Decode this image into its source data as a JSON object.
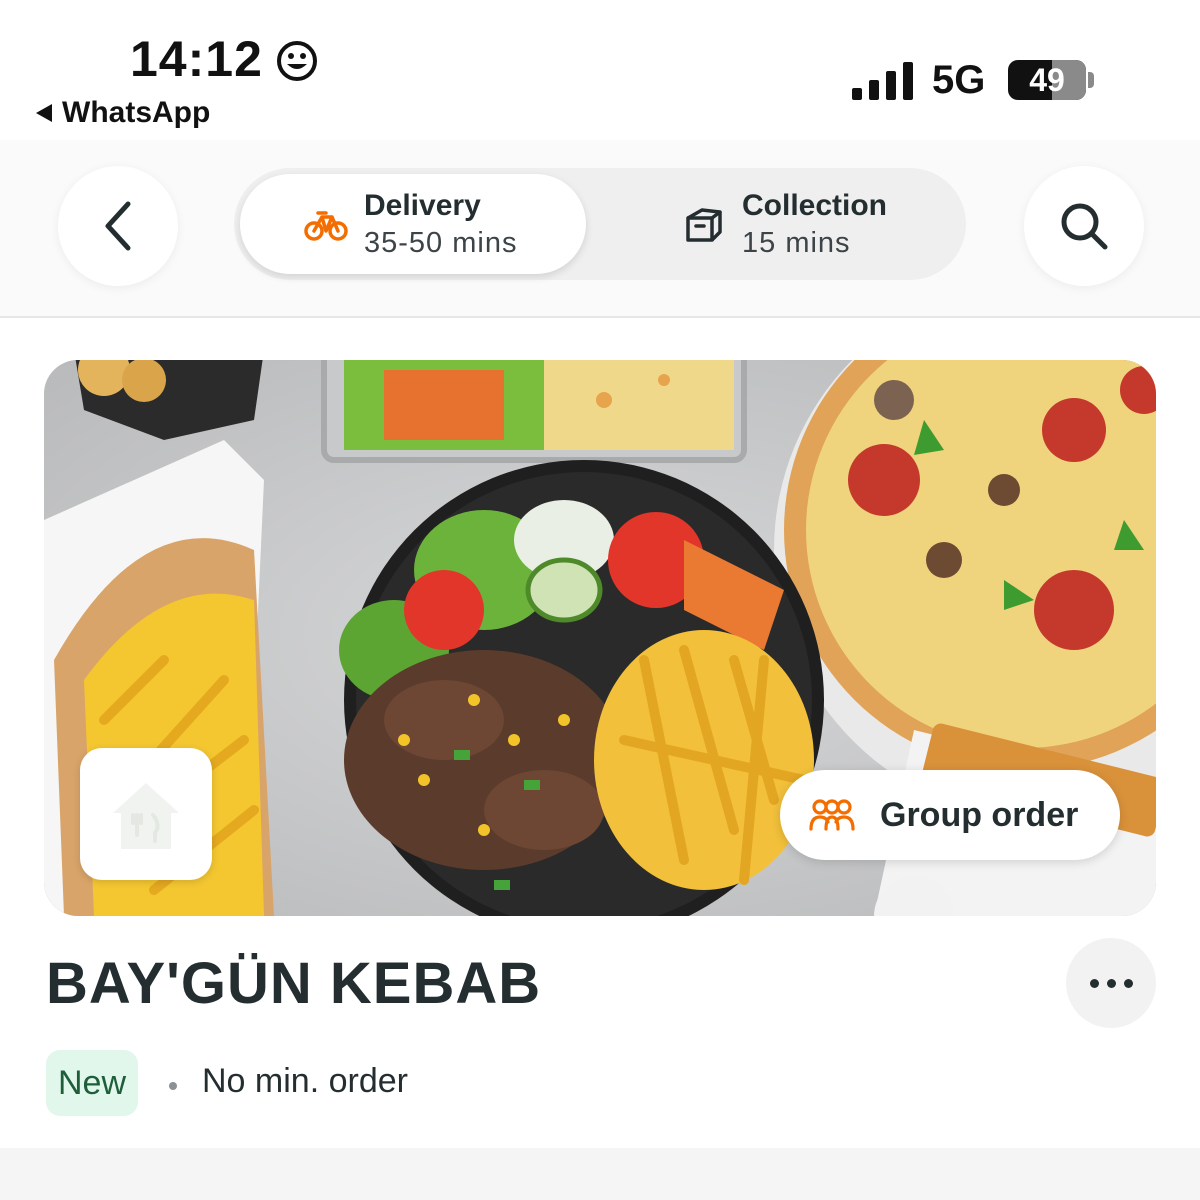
{
  "status_bar": {
    "time": "14:12",
    "back_app": "WhatsApp",
    "network": "5G",
    "battery": "49",
    "battery_level_percent": 49
  },
  "nav": {
    "back_icon": "chevron-left-icon",
    "search_icon": "search-icon",
    "modes": [
      {
        "label": "Delivery",
        "sub": "35-50 mins",
        "icon": "bike-icon",
        "selected": true
      },
      {
        "label": "Collection",
        "sub": "15 mins",
        "icon": "collection-bag-icon",
        "selected": false
      }
    ]
  },
  "hero": {
    "image": "food-photo (kebab plate, fries, pizza, salad tray, hot dog)",
    "logo_icon": "restaurant-logo-placeholder-icon",
    "group_order": {
      "label": "Group order",
      "icon": "group-icon"
    }
  },
  "restaurant": {
    "name": "BAY'GÜN KEBAB",
    "badge": "New",
    "min_order": "No min. order",
    "more_icon": "more-options-icon"
  },
  "colors": {
    "accent_orange": "#f36d00",
    "text_dark": "#242e30",
    "badge_bg": "#e2f7ec",
    "badge_text": "#1e5f3a"
  }
}
